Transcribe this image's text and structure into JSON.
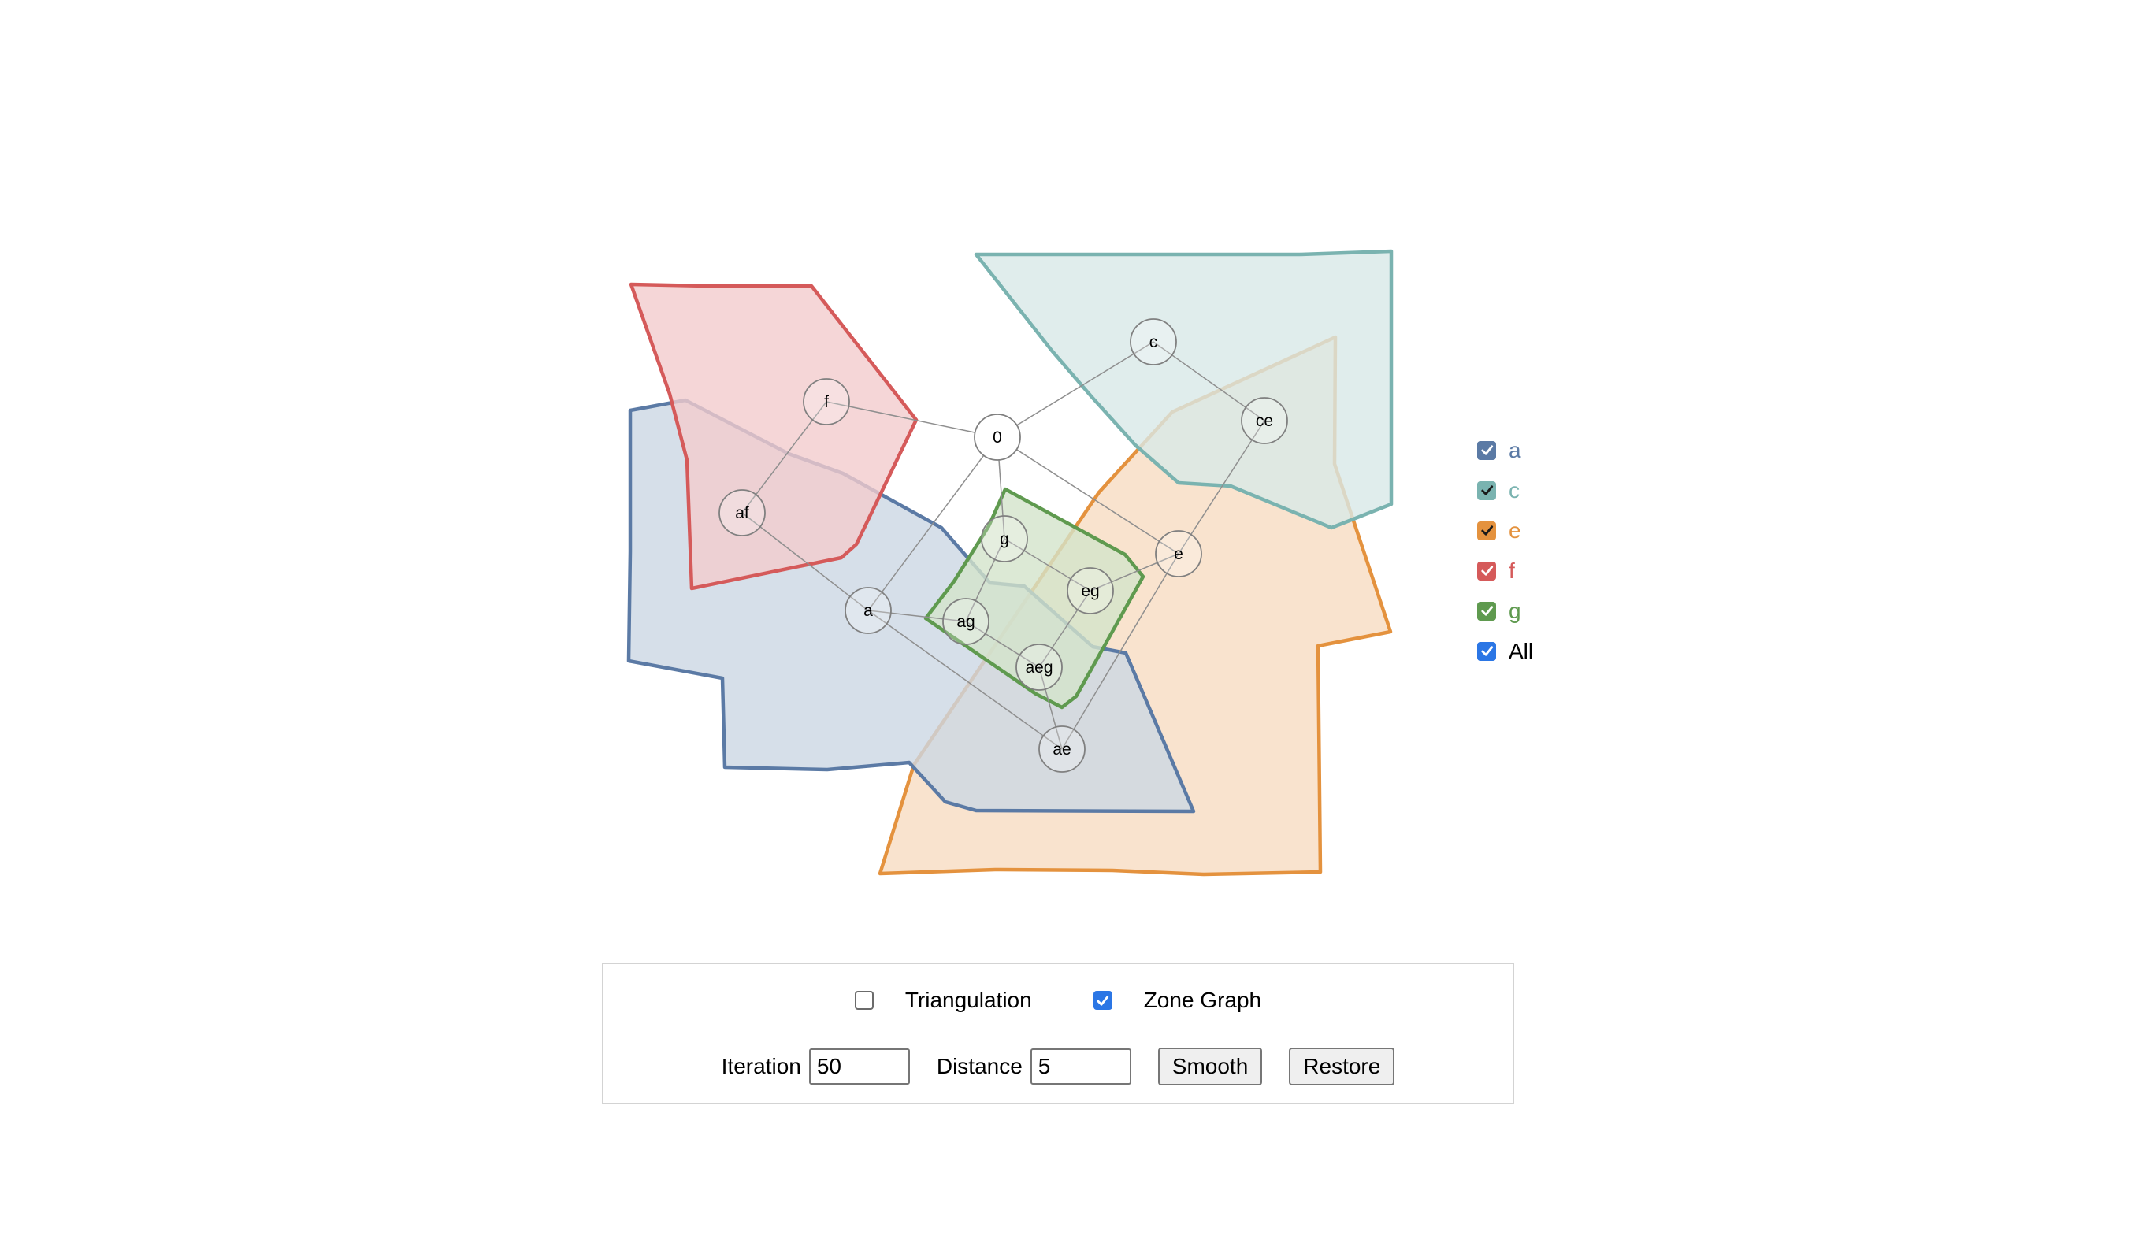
{
  "sets": [
    {
      "label": "a",
      "color": "#5b7aa5",
      "fill": "#ccd7e4",
      "checked": true
    },
    {
      "label": "c",
      "color": "#7ab3b0",
      "fill": "#d8e8e7",
      "checked": true
    },
    {
      "label": "e",
      "color": "#e4923e",
      "fill": "#f7dcc2",
      "checked": true
    },
    {
      "label": "f",
      "color": "#d55a5a",
      "fill": "#f2cccd",
      "checked": true
    },
    {
      "label": "g",
      "color": "#5f9a4f",
      "fill": "#d3e3cb",
      "checked": true
    }
  ],
  "legend_all": {
    "label": "All",
    "checked": true,
    "color": "#2b76e5"
  },
  "zones": [
    "0",
    "c",
    "ce",
    "f",
    "af",
    "g",
    "eg",
    "e",
    "a",
    "ag",
    "aeg",
    "ae"
  ],
  "controls": {
    "triangulation": {
      "label": "Triangulation",
      "checked": false
    },
    "zone_graph": {
      "label": "Zone Graph",
      "checked": true
    },
    "iteration": {
      "label": "Iteration",
      "value": "50"
    },
    "distance": {
      "label": "Distance",
      "value": "5"
    },
    "smooth_label": "Smooth",
    "restore_label": "Restore"
  }
}
